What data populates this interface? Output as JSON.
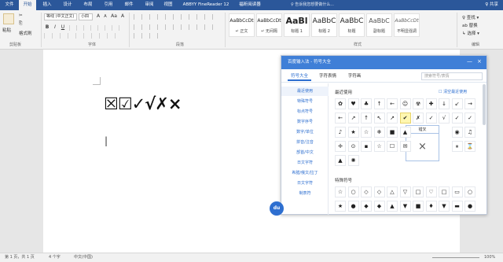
{
  "ribbon_tabs": [
    "文件",
    "开始",
    "插入",
    "设计",
    "布局",
    "引用",
    "邮件",
    "审阅",
    "视图",
    "ABBYY FineReader 12",
    "福昕阅读器"
  ],
  "active_tab": "开始",
  "search_tip": "♀ 告诉我您想要做什么...",
  "share_label": "♀ 共享",
  "clipboard": {
    "paste": "粘贴",
    "cut": "✂",
    "copy": "⎘",
    "format_painter": "格式刷",
    "label": "剪贴板"
  },
  "font": {
    "family": "等线 (中文正文)",
    "size": "小四",
    "label": "字体",
    "bold": "B",
    "italic": "I",
    "underline": "U",
    "grow": "A",
    "shrink": "A",
    "aa": "Aa",
    "clear": "A"
  },
  "paragraph": {
    "label": "段落"
  },
  "styles": {
    "label": "样式",
    "items": [
      {
        "preview": "AaBbCcDt",
        "name": "↵ 正文"
      },
      {
        "preview": "AaBbCcDt",
        "name": "↵ 无间隔"
      },
      {
        "preview": "AaBl",
        "name": "标题 1"
      },
      {
        "preview": "AaBbC",
        "name": "标题 2"
      },
      {
        "preview": "AaBbC",
        "name": "标题"
      },
      {
        "preview": "AaBbC",
        "name": "副标题"
      },
      {
        "preview": "AaBbCcDt",
        "name": "不明显强调"
      }
    ]
  },
  "editing": {
    "find": "♀ 查找 ▾",
    "replace": "ab 替换",
    "select": "↳ 选择 ▾",
    "label": "编辑"
  },
  "document": {
    "symbols_line": "☒☑✓√✗×",
    "cursor": "|"
  },
  "status": {
    "page": "第 1 页，共 1 页",
    "words": "4 个字",
    "lang": "中文(中国)",
    "zoom": "100%"
  },
  "ime": {
    "title": "百度输入法 - 符号大全",
    "tabs": [
      "符号大全",
      "字符表情",
      "字符画"
    ],
    "search_placeholder": "搜索符号/表情",
    "categories": [
      "最近使用",
      "特殊符号",
      "标点符号",
      "数字序号",
      "数字/单位",
      "拼音/注音",
      "部首/中文",
      "日文字符",
      "希腊/俄文/拉丁",
      "日文字符",
      "制表符"
    ],
    "recent_label": "最近使用",
    "clear_recent": "☐ 清空最近使用",
    "recent_row1": [
      "✿",
      "♥",
      "♣",
      "↑",
      "←",
      "☺",
      "☢",
      "✚",
      "↓",
      "↙",
      "→"
    ],
    "recent_row2": [
      "←",
      "↗",
      "↑",
      "↖",
      "↗",
      "✔",
      "✗",
      "✓",
      "√",
      "✓",
      "✓"
    ],
    "recent_row3": [
      "♪",
      "★",
      "☆",
      "❄",
      "■",
      "▲",
      "▶",
      "△",
      "▶",
      "◉",
      "♫"
    ],
    "recent_row4": [
      "✛",
      "⊙",
      "▪",
      "☆",
      "☐",
      "✉",
      "▽",
      "□",
      "■",
      "⏸",
      "⌛"
    ],
    "recent_row5": [
      "▲",
      "✺"
    ],
    "special_label": "特殊符号",
    "special_row1": [
      "☆",
      "○",
      "◇",
      "◇",
      "△",
      "▽",
      "□",
      "♡",
      "□",
      "▭",
      "○"
    ],
    "special_row2": [
      "★",
      "●",
      "◆",
      "◆",
      "▲",
      "▼",
      "■",
      "♦",
      "▼",
      "▬",
      "●"
    ],
    "tooltip_label": "错叉",
    "tooltip_symbol": "×",
    "badge": "du"
  }
}
